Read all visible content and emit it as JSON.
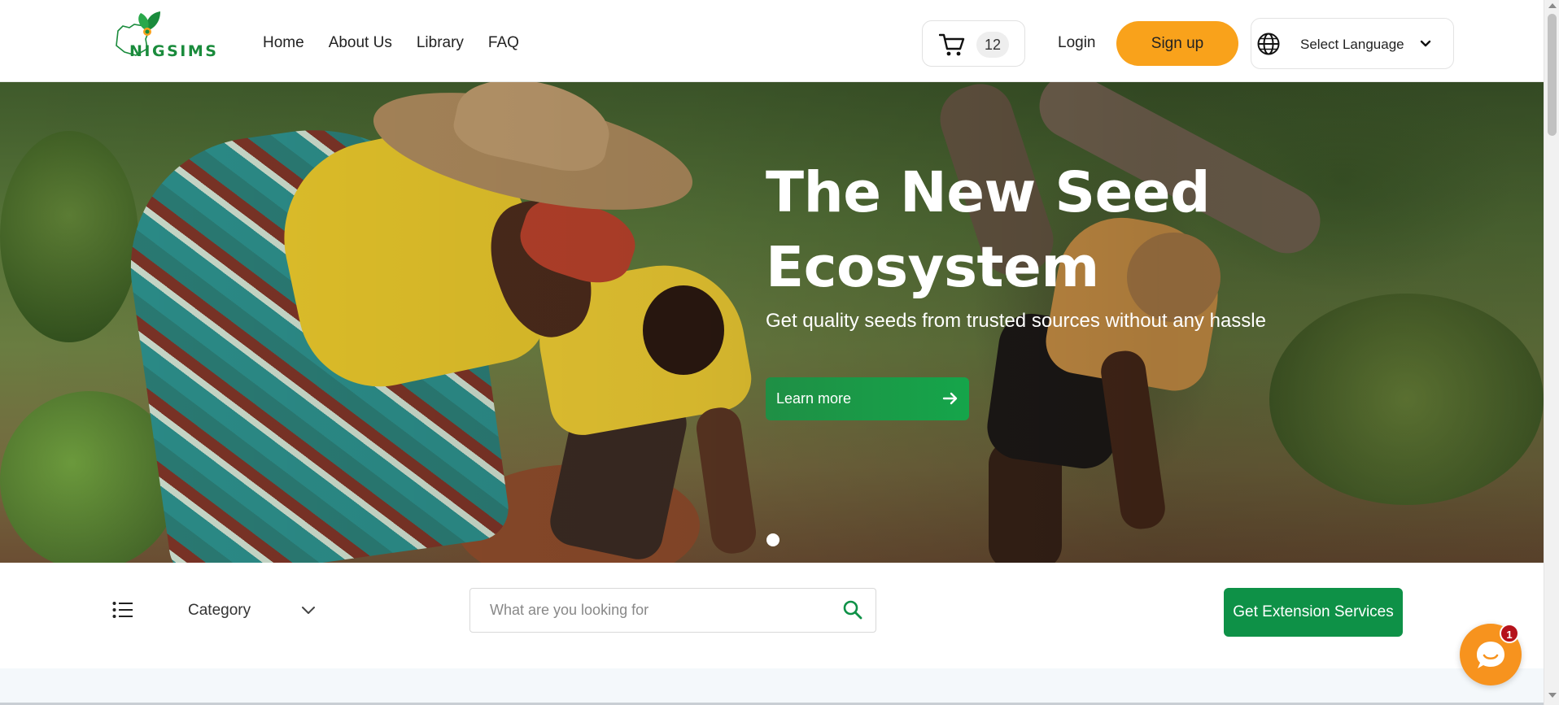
{
  "header": {
    "logo_text": "NIGSIMS",
    "nav": [
      "Home",
      "About Us",
      "Library",
      "FAQ"
    ],
    "cart_count": "12",
    "login_label": "Login",
    "signup_label": "Sign up",
    "language_label": "Select Language"
  },
  "hero": {
    "title_line1": "The New Seed",
    "title_line2": "Ecosystem",
    "subtitle": "Get quality seeds from trusted sources without any hassle",
    "cta_label": "Learn more",
    "slide_index": 1,
    "slide_count": 1
  },
  "toolbar": {
    "category_label": "Category",
    "search_placeholder": "What are you looking for",
    "extension_label": "Get Extension Services"
  },
  "chat": {
    "badge_count": "1"
  },
  "colors": {
    "brand_green": "#1a8b3c",
    "button_green": "#0e9147",
    "signup_orange": "#f9a21b",
    "chat_orange": "#f7931e",
    "badge_red": "#b5121b"
  },
  "icons": [
    "cart-icon",
    "globe-icon",
    "chevron-down-icon",
    "arrow-right-icon",
    "list-menu-icon",
    "search-icon",
    "chat-icon"
  ]
}
